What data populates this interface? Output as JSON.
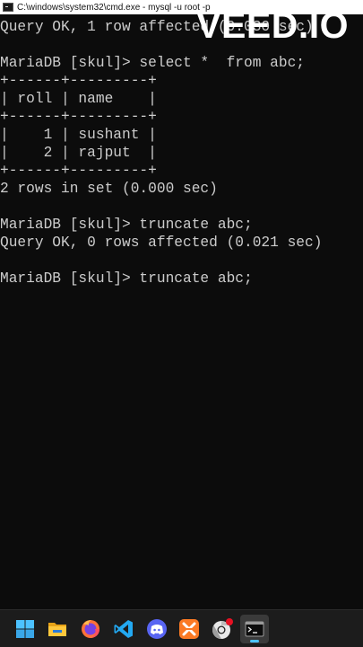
{
  "window": {
    "title": "C:\\windows\\system32\\cmd.exe - mysql  -u root -p"
  },
  "watermark": "VEED.IO",
  "terminal": {
    "lines": [
      "Query OK, 1 row affected (0.030 sec)",
      "",
      "MariaDB [skul]> select *  from abc;",
      "+------+---------+",
      "| roll | name    |",
      "+------+---------+",
      "|    1 | sushant |",
      "|    2 | rajput  |",
      "+------+---------+",
      "2 rows in set (0.000 sec)",
      "",
      "MariaDB [skul]> truncate abc;",
      "Query OK, 0 rows affected (0.021 sec)",
      "",
      "MariaDB [skul]> truncate abc;"
    ]
  },
  "taskbar": {
    "items": [
      {
        "name": "start-windows-icon",
        "active": false
      },
      {
        "name": "file-explorer-icon",
        "active": false
      },
      {
        "name": "firefox-icon",
        "active": false
      },
      {
        "name": "visual-studio-code-icon",
        "active": false
      },
      {
        "name": "discord-icon",
        "active": false
      },
      {
        "name": "xampp-icon",
        "active": false
      },
      {
        "name": "chrome-icon",
        "active": false,
        "badge": true
      },
      {
        "name": "command-prompt-icon",
        "active": true
      }
    ]
  },
  "colors": {
    "terminal_bg": "#0c0c0c",
    "terminal_text": "#cccccc",
    "taskbar_bg": "#1c1c1c",
    "accent": "#4cc2ff"
  }
}
